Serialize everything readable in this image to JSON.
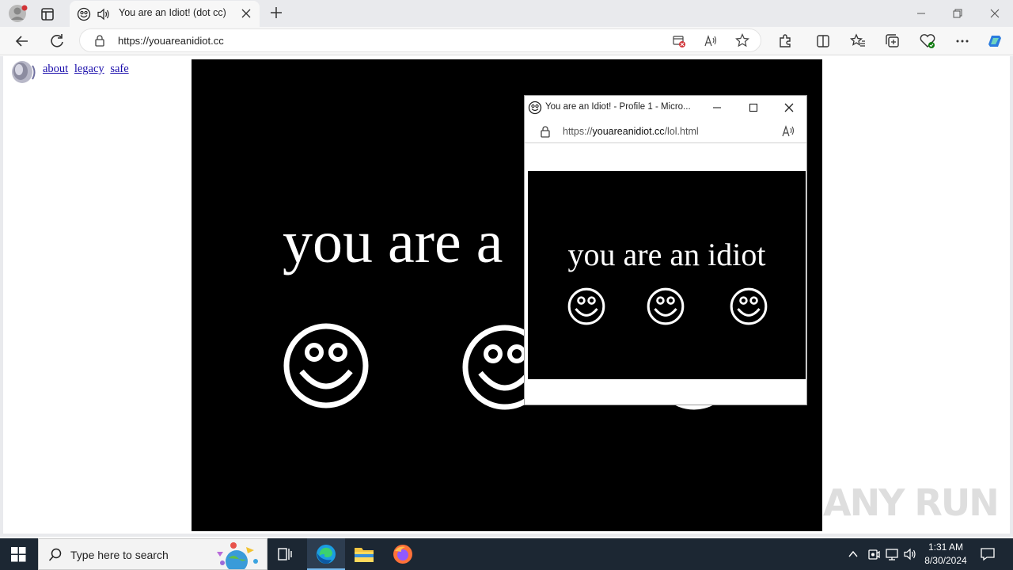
{
  "browser": {
    "tab_title": "You are an Idiot! (dot cc)",
    "url": "https://youareanidiot.cc"
  },
  "page": {
    "links": [
      "about",
      "legacy",
      "safe"
    ],
    "main_text": "you are a"
  },
  "popup": {
    "window_title": "You are an Idiot! - Profile 1 - Micro...",
    "url_prefix": "https://",
    "url_host": "youareanidiot.cc",
    "url_path": "/lol.html",
    "text": "you are an idiot"
  },
  "taskbar": {
    "search_placeholder": "Type here to search",
    "time": "1:31 AM",
    "date": "8/30/2024"
  },
  "watermark": "ANY RUN",
  "colors": {
    "accent": "#0078d4",
    "page_bg": "#000000",
    "taskbar": "#1c2733"
  }
}
